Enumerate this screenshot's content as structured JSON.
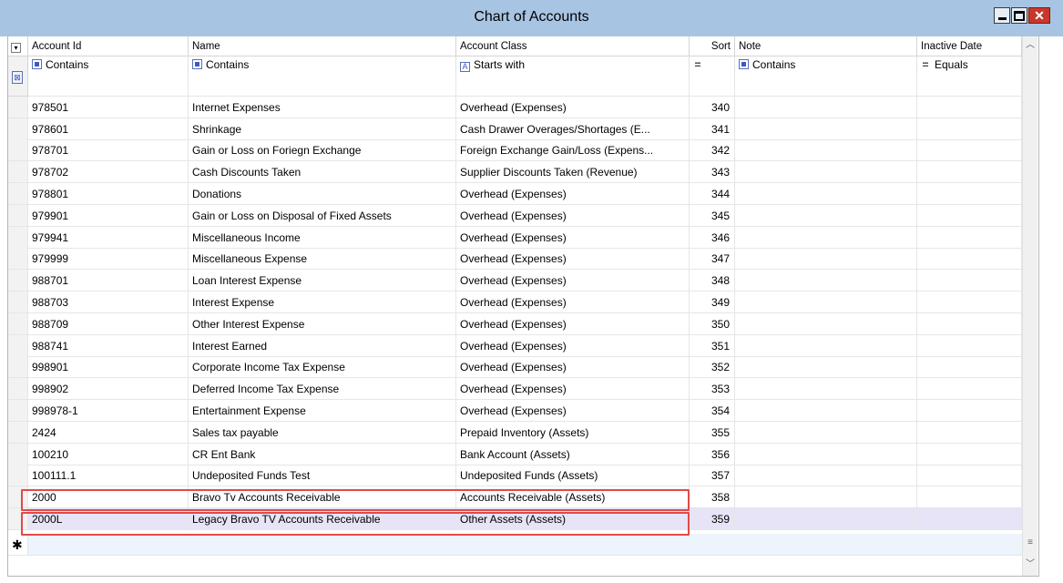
{
  "window": {
    "title": "Chart of Accounts",
    "close_glyph": "✕"
  },
  "columns": [
    {
      "key": "id",
      "label": "Account Id",
      "filter_op": "Contains",
      "filter_icon": "contains-icon"
    },
    {
      "key": "name",
      "label": "Name",
      "filter_op": "Contains",
      "filter_icon": "contains-icon"
    },
    {
      "key": "cls",
      "label": "Account Class",
      "filter_op": "Starts with",
      "filter_icon": "starts-with-icon"
    },
    {
      "key": "sort",
      "label": "Sort",
      "filter_op": "=",
      "filter_icon": "equals-icon"
    },
    {
      "key": "note",
      "label": "Note",
      "filter_op": "Contains",
      "filter_icon": "contains-icon"
    },
    {
      "key": "inactive",
      "label": "Inactive Date",
      "filter_op": "Equals",
      "filter_icon": "equals-icon"
    }
  ],
  "rows": [
    {
      "id": "",
      "name": "",
      "cls": "",
      "sort": ""
    },
    {
      "id": "978501",
      "name": "Internet Expenses",
      "cls": "Overhead (Expenses)",
      "sort": "340"
    },
    {
      "id": "978601",
      "name": "Shrinkage",
      "cls": "Cash Drawer Overages/Shortages (E...",
      "sort": "341"
    },
    {
      "id": "978701",
      "name": "Gain or Loss on Foriegn Exchange",
      "cls": "Foreign Exchange Gain/Loss (Expens...",
      "sort": "342"
    },
    {
      "id": "978702",
      "name": "Cash Discounts Taken",
      "cls": "Supplier Discounts Taken (Revenue)",
      "sort": "343"
    },
    {
      "id": "978801",
      "name": "Donations",
      "cls": "Overhead (Expenses)",
      "sort": "344"
    },
    {
      "id": "979901",
      "name": "Gain or Loss on Disposal of Fixed Assets",
      "cls": "Overhead (Expenses)",
      "sort": "345"
    },
    {
      "id": "979941",
      "name": "Miscellaneous Income",
      "cls": "Overhead (Expenses)",
      "sort": "346"
    },
    {
      "id": "979999",
      "name": "Miscellaneous Expense",
      "cls": "Overhead (Expenses)",
      "sort": "347"
    },
    {
      "id": "988701",
      "name": "Loan Interest Expense",
      "cls": "Overhead (Expenses)",
      "sort": "348"
    },
    {
      "id": "988703",
      "name": "Interest Expense",
      "cls": "Overhead (Expenses)",
      "sort": "349"
    },
    {
      "id": "988709",
      "name": "Other Interest Expense",
      "cls": "Overhead (Expenses)",
      "sort": "350"
    },
    {
      "id": "988741",
      "name": "Interest Earned",
      "cls": "Overhead (Expenses)",
      "sort": "351"
    },
    {
      "id": "998901",
      "name": "Corporate Income Tax Expense",
      "cls": "Overhead (Expenses)",
      "sort": "352"
    },
    {
      "id": "998902",
      "name": "Deferred Income Tax Expense",
      "cls": "Overhead (Expenses)",
      "sort": "353"
    },
    {
      "id": "998978-1",
      "name": "Entertainment Expense",
      "cls": "Overhead (Expenses)",
      "sort": "354"
    },
    {
      "id": "2424",
      "name": "Sales tax payable",
      "cls": "Prepaid Inventory (Assets)",
      "sort": "355"
    },
    {
      "id": "100210",
      "name": "CR Ent Bank",
      "cls": "Bank Account (Assets)",
      "sort": "356"
    },
    {
      "id": "100111.1",
      "name": "Undeposited Funds Test",
      "cls": "Undeposited Funds (Assets)",
      "sort": "357"
    },
    {
      "id": "2000",
      "name": "Bravo Tv Accounts Receivable",
      "cls": "Accounts Receivable (Assets)",
      "sort": "358"
    },
    {
      "id": "2000L",
      "name": "Legacy Bravo TV Accounts Receivable",
      "cls": "Other Assets (Assets)",
      "sort": "359"
    }
  ],
  "new_row_glyph": "✱",
  "colors": {
    "titlebar": "#a8c4e3",
    "highlight": "#e14a4a",
    "selected_row": "#e6e4f6"
  }
}
